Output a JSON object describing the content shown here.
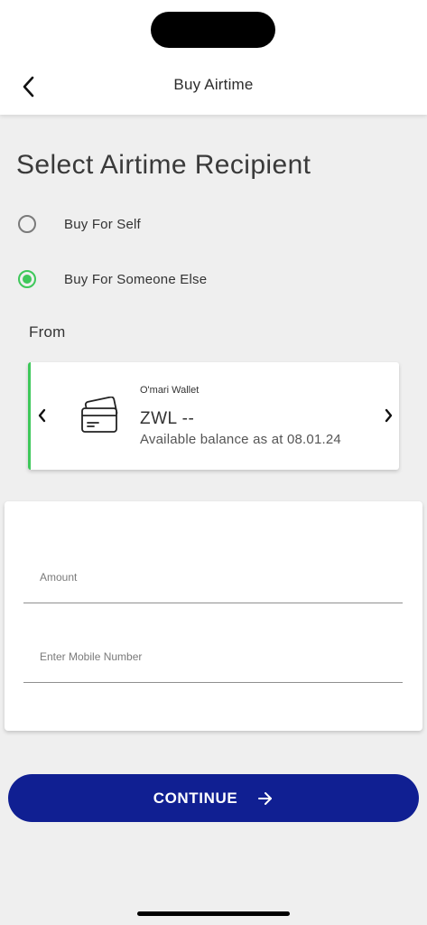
{
  "header": {
    "title": "Buy Airtime",
    "back_icon": "chevron-left-icon"
  },
  "recipient": {
    "title": "Select Airtime Recipient",
    "options": [
      {
        "label": "Buy For Self",
        "selected": false
      },
      {
        "label": "Buy For Someone Else",
        "selected": true
      }
    ]
  },
  "from": {
    "label": "From",
    "wallet": {
      "name": "O'mari Wallet",
      "amount": "ZWL --",
      "balance_text": "Available balance as at 08.01.24",
      "icon": "credit-card-icon",
      "accent_color": "#3ec85a"
    }
  },
  "form": {
    "amount_placeholder": "Amount",
    "amount_value": "",
    "mobile_placeholder": "Enter Mobile Number",
    "mobile_value": ""
  },
  "actions": {
    "continue_label": "CONTINUE",
    "continue_icon": "arrow-right-icon",
    "button_color": "#101f92"
  }
}
